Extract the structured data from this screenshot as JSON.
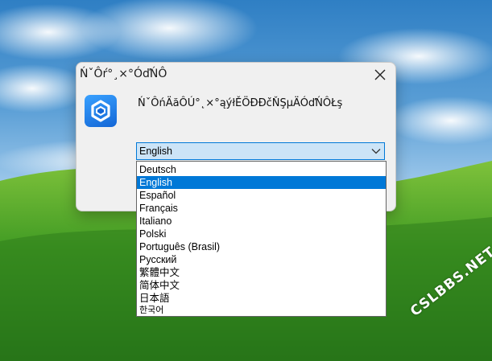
{
  "dialog": {
    "title": "ŃˇÔŕ°¸×°ÓďŃÔ",
    "prompt": "ŃˇÔńÄăÔÚ°˛×°ąýłĚÖĐĐčŇŞµÄÓďŃÔŁş",
    "close_icon": "close-icon",
    "app_icon": "installer-logo-icon"
  },
  "language_select": {
    "selected_value": "English",
    "chevron_icon": "chevron-down-icon",
    "options": [
      "Deutsch",
      "English",
      "Español",
      "Français",
      "Italiano",
      "Polski",
      "Português (Brasil)",
      "Русский",
      "繁體中文",
      "简体中文",
      "日本語",
      "한국어"
    ],
    "selected_index": 1
  },
  "watermark": {
    "text": "CSLBBS.NET"
  },
  "colors": {
    "selection": "#0078d7",
    "combo_background": "#cce4f7",
    "dialog_background": "#f0f0f0"
  }
}
